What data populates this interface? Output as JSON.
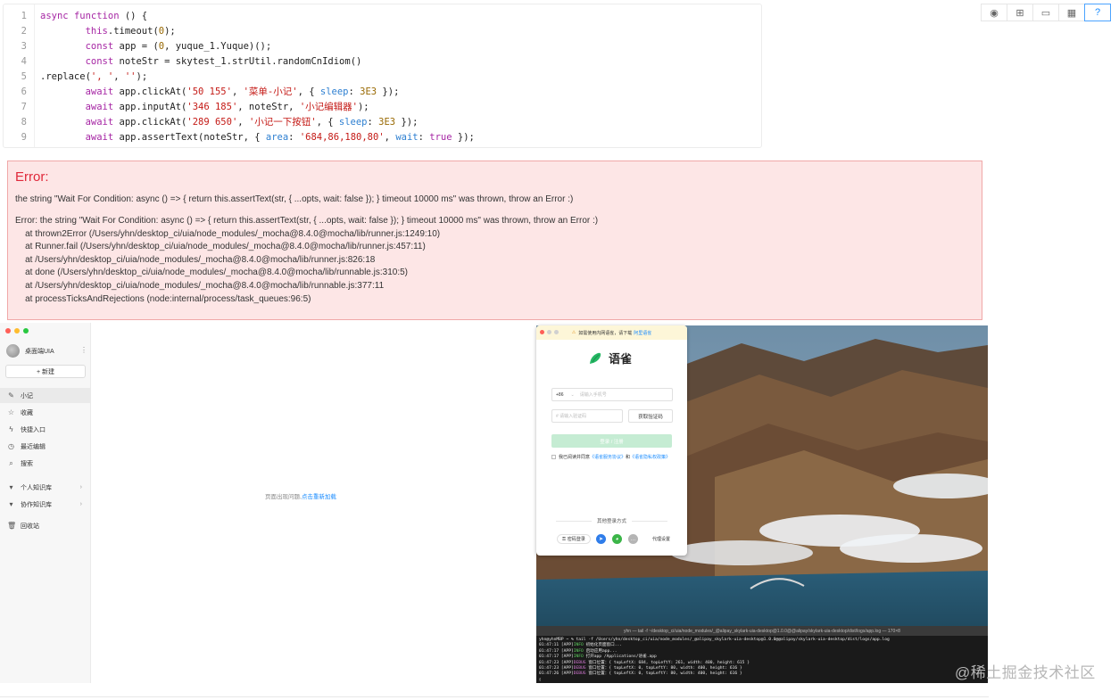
{
  "code": {
    "lines": [
      {
        "n": "1",
        "html": "<span class='kw'>async</span> <span class='kw'>function</span> () {"
      },
      {
        "n": "2",
        "html": "        <span class='kw'>this</span>.timeout(<span class='num'>0</span>);"
      },
      {
        "n": "3",
        "html": "        <span class='kw'>const</span> app = (<span class='num'>0</span>, yuque_1.Yuque)();"
      },
      {
        "n": "4",
        "html": "        <span class='kw'>const</span> noteStr = skytest_1.strUtil.randomCnIdiom()"
      },
      {
        "n": "5",
        "html": ".replace(<span class='str'>', '</span>, <span class='str'>''</span>);"
      },
      {
        "n": "6",
        "html": "        <span class='kw'>await</span> app.clickAt(<span class='str'>'50 155'</span>, <span class='str'>'菜单-小记'</span>, { <span class='prop'>sleep</span>: <span class='num'>3E3</span> });"
      },
      {
        "n": "7",
        "html": "        <span class='kw'>await</span> app.inputAt(<span class='str'>'346 185'</span>, noteStr, <span class='str'>'小记编辑器'</span>);"
      },
      {
        "n": "8",
        "html": "        <span class='kw'>await</span> app.clickAt(<span class='str'>'289 650'</span>, <span class='str'>'小记一下按钮'</span>, { <span class='prop'>sleep</span>: <span class='num'>3E3</span> });"
      },
      {
        "n": "9",
        "html": "        <span class='kw'>await</span> app.assertText(noteStr, { <span class='prop'>area</span>: <span class='str'>'684,86,180,80'</span>, <span class='prop'>wait</span>: <span class='kw'>true</span> });"
      }
    ]
  },
  "toolbar": {
    "buttons": [
      {
        "icon": "eye-icon",
        "glyph": "◉"
      },
      {
        "icon": "hierarchy-icon",
        "glyph": "⊞"
      },
      {
        "icon": "video-icon",
        "glyph": "▭"
      },
      {
        "icon": "table-icon",
        "glyph": "▦"
      },
      {
        "icon": "help-icon",
        "glyph": "?"
      }
    ]
  },
  "error": {
    "title": "Error:",
    "message": "the string \"Wait For Condition: async () => { return this.assertText(str, { ...opts, wait: false }); } timeout 10000 ms\" was thrown, throw an Error :)",
    "stack": "Error: the string \"Wait For Condition: async () => { return this.assertText(str, { ...opts, wait: false }); } timeout 10000 ms\" was thrown, throw an Error :)\n    at thrown2Error (/Users/yhn/desktop_ci/uia/node_modules/_mocha@8.4.0@mocha/lib/runner.js:1249:10)\n    at Runner.fail (/Users/yhn/desktop_ci/uia/node_modules/_mocha@8.4.0@mocha/lib/runner.js:457:11)\n    at /Users/yhn/desktop_ci/uia/node_modules/_mocha@8.4.0@mocha/lib/runner.js:826:18\n    at done (/Users/yhn/desktop_ci/uia/node_modules/_mocha@8.4.0@mocha/lib/runnable.js:310:5)\n    at /Users/yhn/desktop_ci/uia/node_modules/_mocha@8.4.0@mocha/lib/runnable.js:377:11\n    at processTicksAndRejections (node:internal/process/task_queues:96:5)"
  },
  "app": {
    "user": "桌面端UIA",
    "new_button": "+ 新建",
    "nav": [
      {
        "label": "小记",
        "icon": "pen-icon",
        "glyph": "✎",
        "active": true
      },
      {
        "label": "收藏",
        "icon": "star-icon",
        "glyph": "☆"
      },
      {
        "label": "快捷入口",
        "icon": "bolt-icon",
        "glyph": "ϟ"
      },
      {
        "label": "最近编辑",
        "icon": "clock-icon",
        "glyph": "◷"
      },
      {
        "label": "搜索",
        "icon": "search-icon",
        "glyph": "⌕"
      }
    ],
    "groups": [
      {
        "label": "个人知识库"
      },
      {
        "label": "协作知识库"
      }
    ],
    "trash": "回收站",
    "empty_text": "页面出现问题,",
    "reload_link": "点击重新加载"
  },
  "login": {
    "banner_text": "如需使用内网语雀，请下载",
    "banner_link": "阿里语雀",
    "brand": "语雀",
    "country_code": "+86",
    "phone_placeholder": "请输入手机号",
    "code_placeholder": "# 请输入验证码",
    "get_code": "获取验证码",
    "login_button": "登录 / 注册",
    "agree_prefix": "我已阅读并同意",
    "agree_tos": "《语雀服务协议》",
    "agree_and": "和",
    "agree_privacy": "《语雀隐私权政策》",
    "other_methods": "其他登录方式",
    "password_login": "密码登录",
    "proxy_settings": "代理设置"
  },
  "terminal": {
    "title": "yhn — tail -f ~/desktop_ci/uia/node_modules/_@alipay_skylark-uia-desktop@1.0.0@@alipay/skylark-uia-desktop/dist/logs/app.log — 170×8",
    "prompt": "yhn@yhnMBP ~ % tail -f /Users/yhn/desktop_ci/uia/node_modules/_@alipay_skylark-uia-desktop@1.0.0@@alipay/skylark-uia-desktop/dist/logs/app.log",
    "logs": [
      {
        "time": "01:47:11",
        "tag": "INFO",
        "text": "初始化页面窗口..."
      },
      {
        "time": "01:47:17",
        "tag": "INFO",
        "text": "启动应用app..."
      },
      {
        "time": "01:47:17",
        "tag": "INFO",
        "text": "打开app /Applications/语雀.app"
      },
      {
        "time": "01:47:23",
        "tag": "DEBUG",
        "text": "窗口位置：{ topLeftX: 684, topLeftY: 261, width: 400, height: 615 }"
      },
      {
        "time": "01:47:23",
        "tag": "DEBUG",
        "text": "窗口位置：{ topLeftX: 0, topLeftY: 80, width: 400, height: 616 }"
      },
      {
        "time": "01:47:26",
        "tag": "DEBUG",
        "text": "窗口位置：{ topLeftX: 0, topLeftY: 80, width: 400, height: 616 }"
      }
    ]
  },
  "watermark": "@稀土掘金技术社区",
  "colors": {
    "error_bg": "#fde6e6",
    "error_border": "#f0a8a8",
    "error_title": "#e0283a",
    "accent": "#1a8cff",
    "brand_green": "#25b864"
  }
}
